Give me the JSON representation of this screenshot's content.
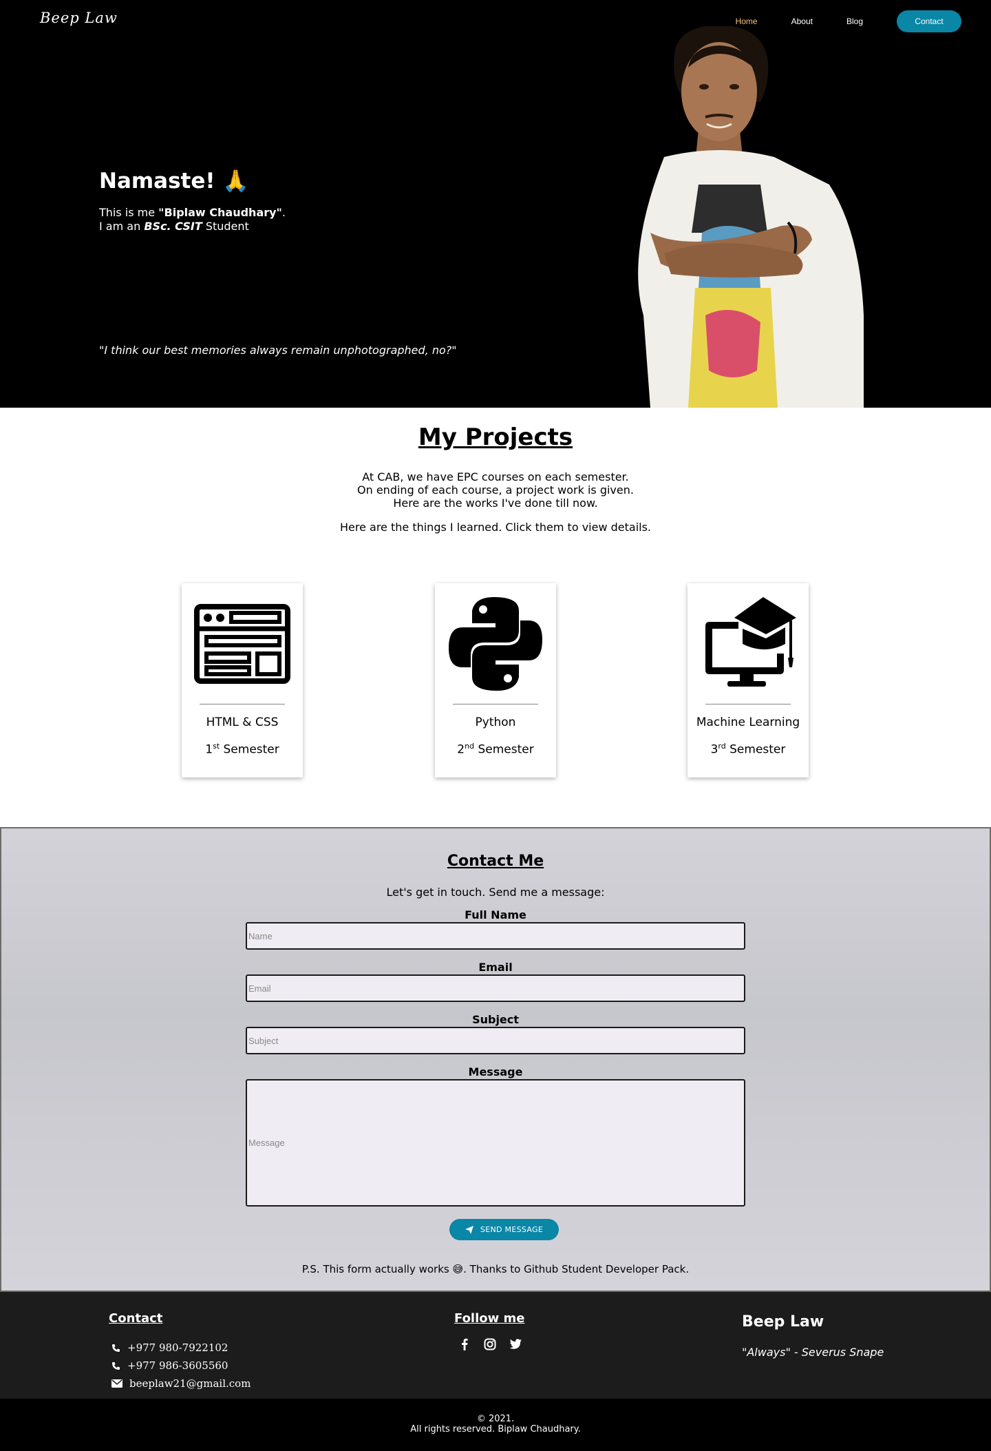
{
  "header": {
    "logo": "Beep Law",
    "nav": [
      "Home",
      "About",
      "Blog"
    ],
    "contact_button": "Contact"
  },
  "hero": {
    "greeting": "Namaste! 🙏",
    "line1_prefix": "This is me ",
    "line1_name": "\"Biplaw Chaudhary\"",
    "line1_suffix": ".",
    "line2_prefix": "I am an ",
    "line2_degree": "BSc. CSIT",
    "line2_suffix": " Student",
    "quote": "\"I think our best memories always remain unphotographed, no?\""
  },
  "projects": {
    "title": "My Projects",
    "desc": [
      "At CAB, we have EPC courses on each semester.",
      "On ending of each course, a project work is given.",
      "Here are the works I've done till now."
    ],
    "hint": "Here are the things I learned. Click them to view details.",
    "cards": [
      {
        "name": "HTML & CSS",
        "num": "1",
        "suffix": "st",
        "sem": " Semester",
        "icon": "web-layout-icon"
      },
      {
        "name": "Python",
        "num": "2",
        "suffix": "nd",
        "sem": " Semester",
        "icon": "python-icon"
      },
      {
        "name": "Machine Learning",
        "num": "3",
        "suffix": "rd",
        "sem": " Semester",
        "icon": "computer-graduation-icon"
      }
    ]
  },
  "contact": {
    "title": "Contact Me",
    "subtitle": "Let's get in touch. Send me a message:",
    "fields": [
      {
        "label": "Full Name",
        "placeholder": "Name"
      },
      {
        "label": "Email",
        "placeholder": "Email"
      },
      {
        "label": "Subject",
        "placeholder": "Subject"
      },
      {
        "label": "Message",
        "placeholder": "Message"
      }
    ],
    "send_label": "SEND MESSAGE",
    "ps": "P.S. This form actually works 😅. Thanks to Github Student Developer Pack."
  },
  "footer": {
    "contact_title": "Contact",
    "phone1": "+977 980-7922102",
    "phone2": "+977 986-3605560",
    "email": "beeplaw21@gmail.com",
    "follow_title": "Follow me",
    "social": [
      "facebook-icon",
      "instagram-icon",
      "twitter-icon"
    ],
    "brand": "Beep Law",
    "quote": "\"Always\" - Severus Snape",
    "copyright1": "© 2021.",
    "copyright2": "All rights reserved. Biplaw Chaudhary."
  },
  "colors": {
    "accent": "#0a86a6",
    "nav_active": "#f5c27a",
    "hero_bg": "#000000",
    "footer_bg": "#1c1c1c"
  }
}
